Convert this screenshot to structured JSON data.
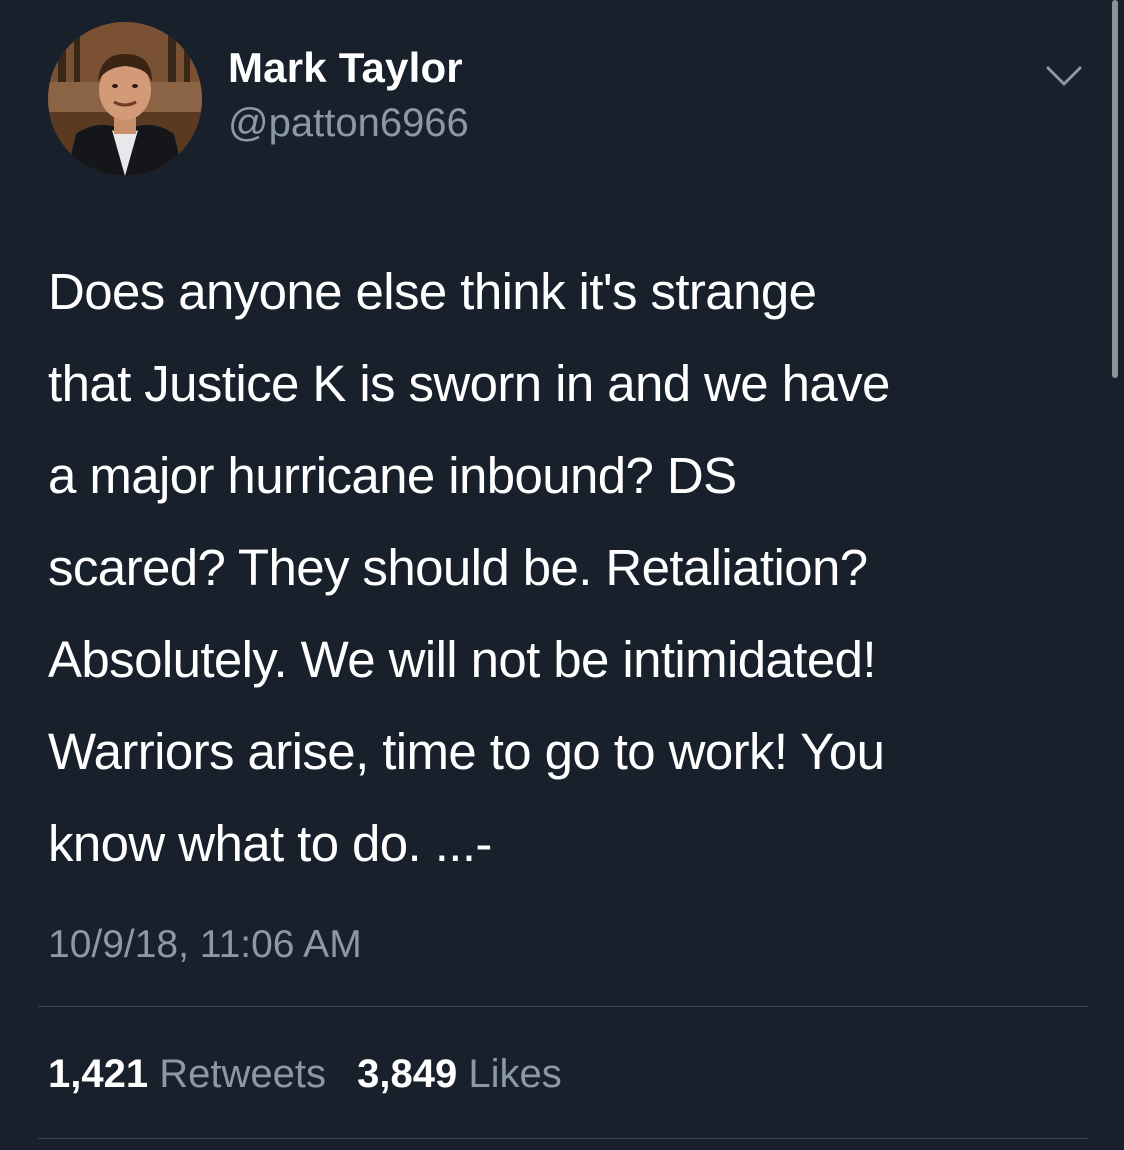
{
  "author": {
    "display_name": "Mark Taylor",
    "handle": "@patton6966"
  },
  "tweet": {
    "text": "Does anyone else think it's strange\nthat Justice K is sworn in and we have\na major hurricane inbound? DS\nscared? They should be.  Retaliation?\nAbsolutely. We will not be intimidated!\nWarriors arise, time to go to work! You\nknow what to do. ...-",
    "timestamp": "10/9/18, 11:06 AM"
  },
  "stats": {
    "retweets_count": "1,421",
    "retweets_label": "Retweets",
    "likes_count": "3,849",
    "likes_label": "Likes"
  },
  "icons": {
    "menu": "chevron-down-icon",
    "avatar": "profile-photo"
  },
  "colors": {
    "background": "#18202c",
    "primary_text": "#ffffff",
    "secondary_text": "#8b98a5",
    "divider": "#38444d"
  }
}
